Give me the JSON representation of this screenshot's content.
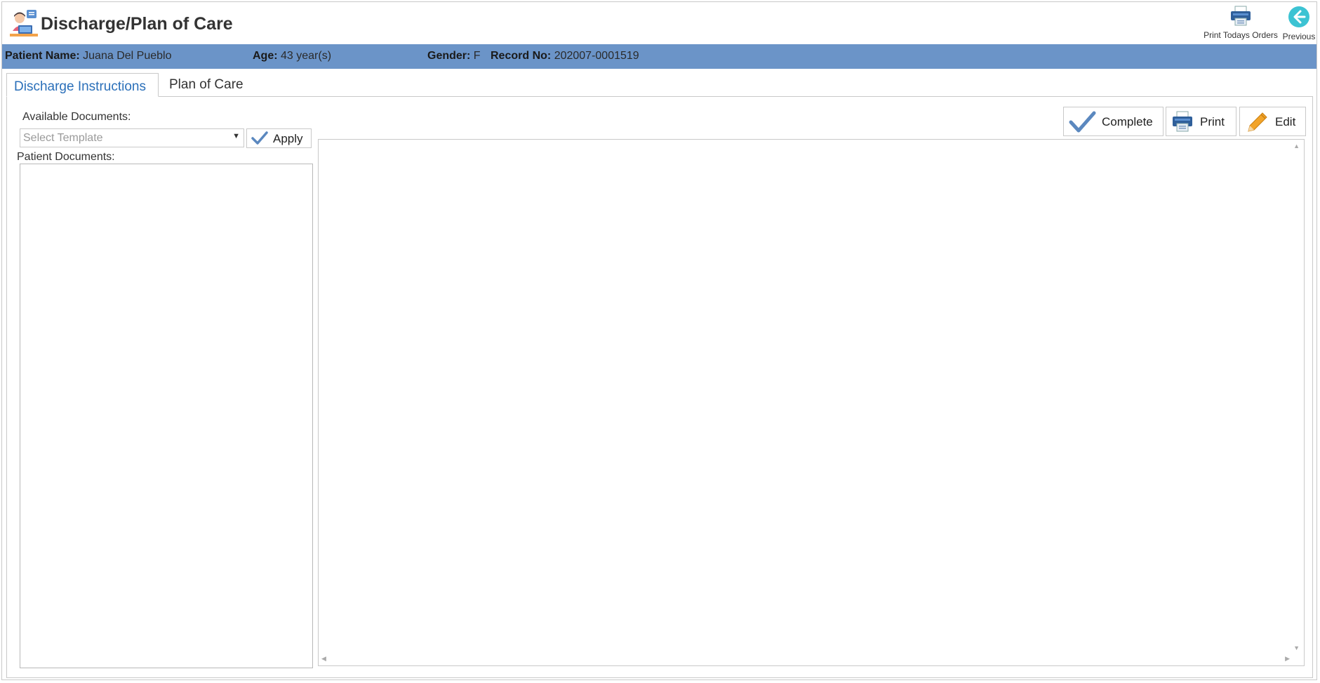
{
  "header": {
    "title": "Discharge/Plan of Care",
    "print_orders_label": "Print Todays Orders",
    "previous_label": "Previous"
  },
  "patient": {
    "name_label": "Patient Name:",
    "name_value": "Juana Del Pueblo",
    "age_label": "Age:",
    "age_value": "43 year(s)",
    "gender_label": "Gender:",
    "gender_value": "F",
    "record_label": "Record No:",
    "record_value": "202007-0001519"
  },
  "tabs": [
    {
      "label": "Discharge Instructions",
      "active": true
    },
    {
      "label": "Plan of Care",
      "active": false
    }
  ],
  "left_panel": {
    "available_label": "Available Documents:",
    "template_placeholder": "Select Template",
    "apply_label": "Apply",
    "patient_docs_label": "Patient Documents:"
  },
  "toolbar": {
    "complete_label": "Complete",
    "print_label": "Print",
    "edit_label": "Edit"
  },
  "colors": {
    "patient_bar": "#6b94c8",
    "active_tab_text": "#2a6fb9",
    "check_blue": "#5b88bf",
    "previous_teal": "#3cc3d3",
    "pencil_orange": "#f2a42a"
  }
}
